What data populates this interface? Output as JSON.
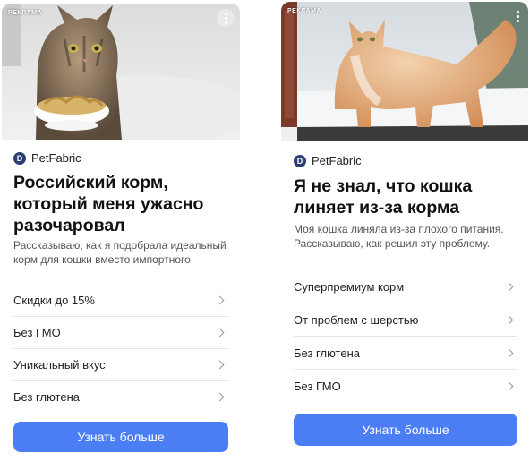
{
  "ads": [
    {
      "ad_label": "РЕКЛАМА",
      "image_icon": "cat-with-food-bowl",
      "brand_logo": "D",
      "brand_name": "PetFabric",
      "headline": "Российский корм, который меня ужасно разочаровал",
      "description": "Рассказываю, как я подобрала идеальный корм для кошки вместо импортного.",
      "features": [
        "Скидки до 15%",
        "Без ГМО",
        "Уникальный вкус",
        "Без глютена"
      ],
      "cta": "Узнать больше"
    },
    {
      "ad_label": "РЕКЛАМА",
      "image_icon": "maine-coon-cat-in-snow",
      "brand_logo": "D",
      "brand_name": "PetFabric",
      "headline": "Я не знал, что кошка линяет из-за корма",
      "description": "Моя кошка линяла из-за плохого питания. Рассказываю, как решил эту проблему.",
      "features": [
        "Суперпремиум корм",
        "От проблем с шерстью",
        "Без глютена",
        "Без ГМО"
      ],
      "cta": "Узнать больше"
    }
  ],
  "colors": {
    "cta_background": "#4b7ef5",
    "brand_logo_background": "#2c3e73",
    "divider": "#e6e6e6"
  }
}
